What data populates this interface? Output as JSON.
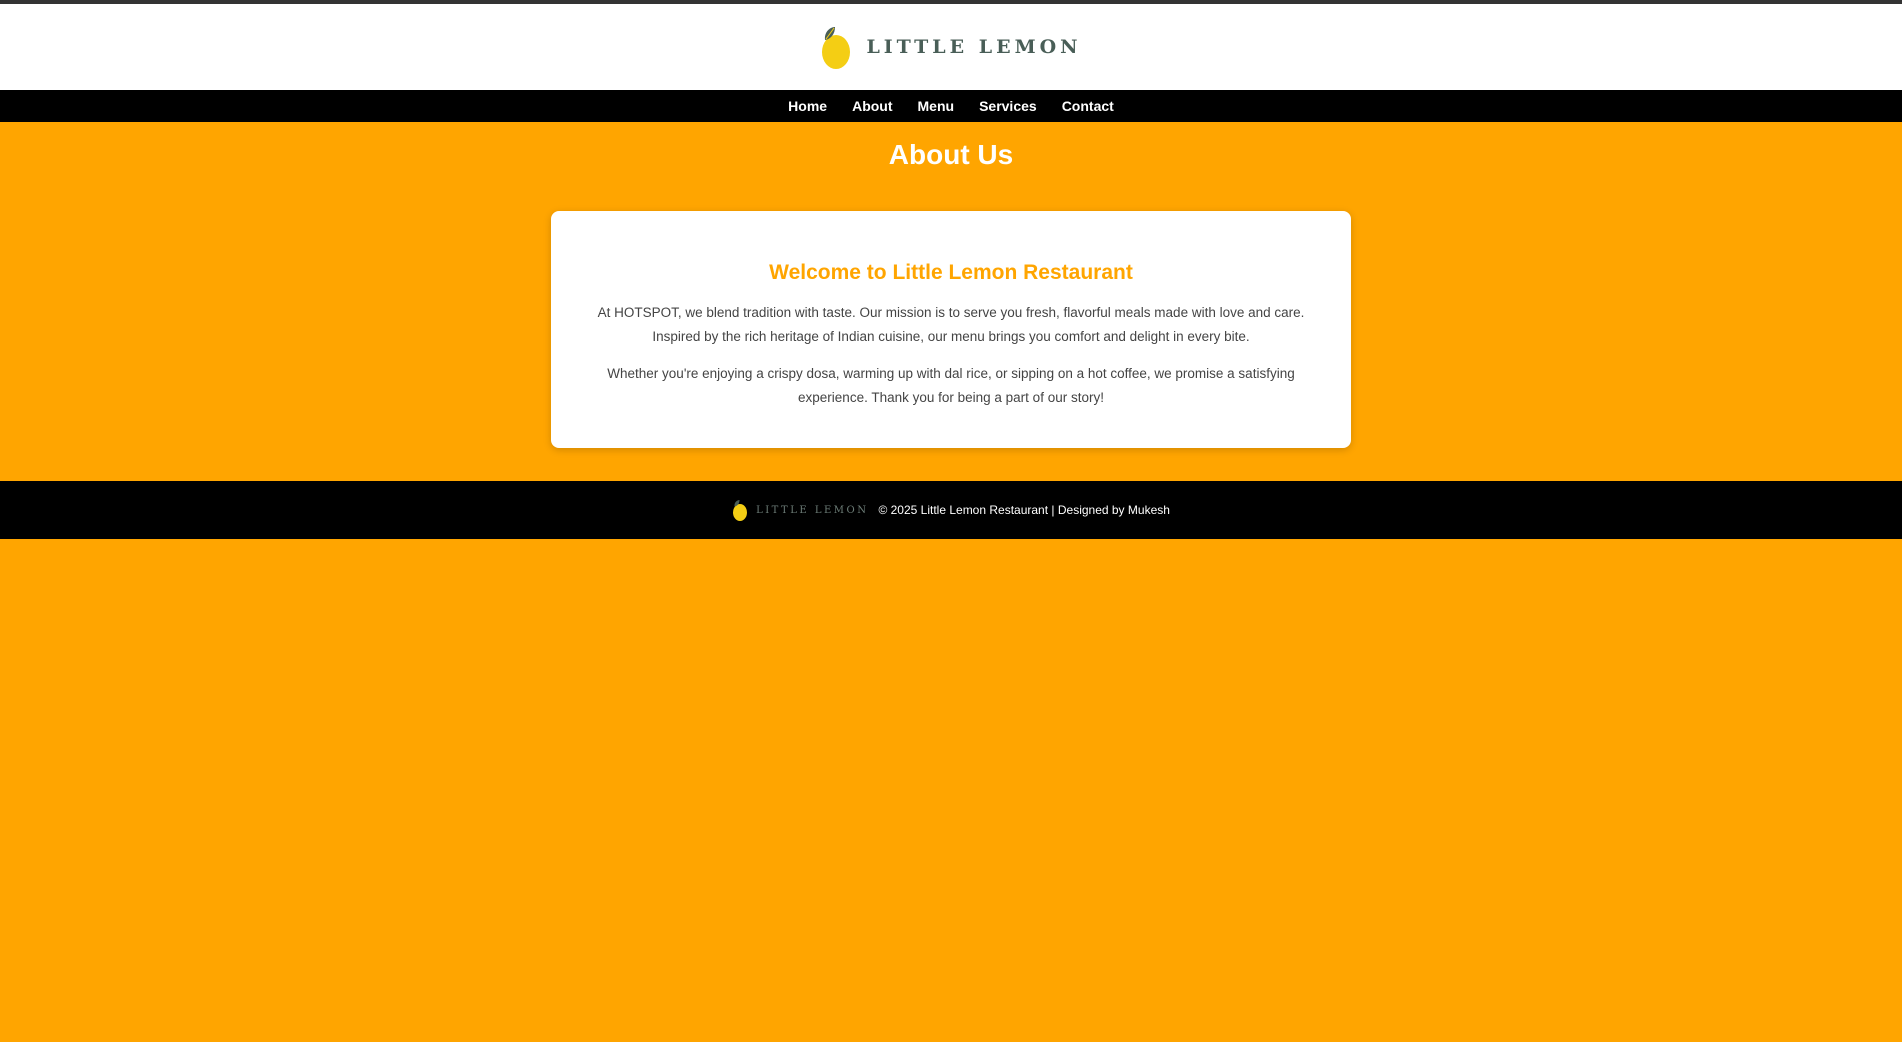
{
  "brand": {
    "name": "LITTLE LEMON",
    "logo_icon": "lemon-icon",
    "colors": {
      "lemon": "#F4CE14",
      "leaf": "#495E57",
      "accent": "#FFA500",
      "dark": "#000000"
    }
  },
  "nav": {
    "items": [
      {
        "label": "Home"
      },
      {
        "label": "About"
      },
      {
        "label": "Menu"
      },
      {
        "label": "Services"
      },
      {
        "label": "Contact"
      }
    ]
  },
  "page": {
    "title": "About Us"
  },
  "about": {
    "heading": "Welcome to Little Lemon Restaurant",
    "paragraphs": [
      "At HOTSPOT, we blend tradition with taste. Our mission is to serve you fresh, flavorful meals made with love and care. Inspired by the rich heritage of Indian cuisine, our menu brings you comfort and delight in every bite.",
      "Whether you're enjoying a crispy dosa, warming up with dal rice, or sipping on a hot coffee, we promise a satisfying experience. Thank you for being a part of our story!"
    ]
  },
  "footer": {
    "brand_name": "LITTLE LEMON",
    "copyright": "© 2025 Little Lemon Restaurant | Designed by Mukesh"
  }
}
